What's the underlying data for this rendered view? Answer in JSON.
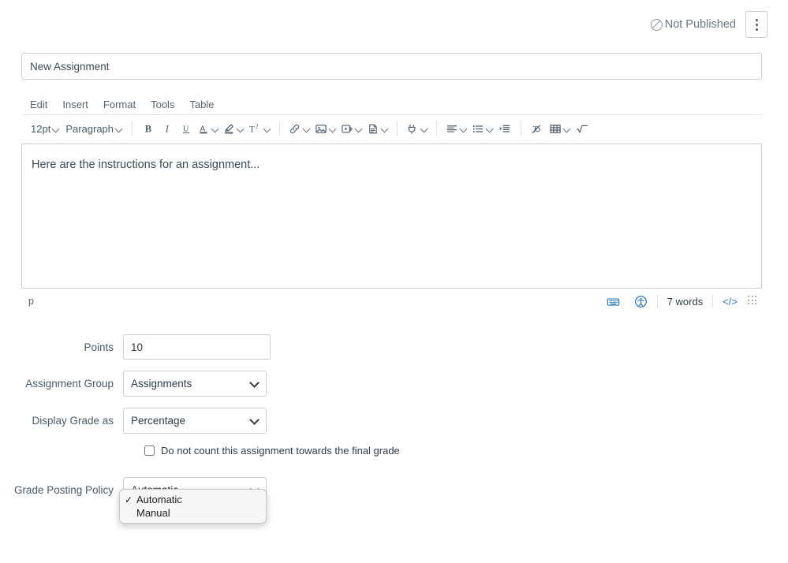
{
  "topbar": {
    "publish_status": "Not Published",
    "publish_icon": "no-entry-icon",
    "kebab_label": "More options",
    "kebab_icon": "kebab-menu-icon"
  },
  "title": {
    "placeholder": "New Assignment",
    "value": ""
  },
  "editor": {
    "menubar": [
      {
        "label": "Edit"
      },
      {
        "label": "Insert"
      },
      {
        "label": "Format"
      },
      {
        "label": "Tools"
      },
      {
        "label": "Table"
      }
    ],
    "toolbar": {
      "font_size": "12pt",
      "block_format": "Paragraph",
      "bold": "B",
      "italic": "I",
      "underline": "U",
      "text_color": "A",
      "highlight": "highlight-icon",
      "superscript": "T²",
      "link": "link-icon",
      "image": "image-icon",
      "media": "media-icon",
      "document": "document-icon",
      "apps": "plug-icon",
      "align": "align-left-icon",
      "list": "bulleted-list-icon",
      "indent": "indent-icon",
      "clear_format": "clear-formatting-icon",
      "table": "table-icon",
      "equation": "math-equation-icon"
    },
    "body_text": "Here are the instructions for an assignment...",
    "statusbar": {
      "element_path": "p",
      "keyboard_icon": "keyboard-shortcuts-icon",
      "accessibility_icon": "accessibility-checker-icon",
      "word_count": "7 words",
      "html_editor": "</>",
      "resize_handle": "resize-grip-icon"
    }
  },
  "form": {
    "points": {
      "label": "Points",
      "value": "10"
    },
    "assignment_group": {
      "label": "Assignment Group",
      "value": "Assignments",
      "options": [
        "Assignments"
      ]
    },
    "display_grade_as": {
      "label": "Display Grade as",
      "value": "Percentage",
      "options": [
        "Percentage"
      ]
    },
    "omit_from_final": {
      "label": "Do not count this assignment towards the final grade",
      "checked": false
    },
    "grade_posting_policy": {
      "label": "Grade Posting Policy",
      "value": "Automatic",
      "options": [
        "Automatic",
        "Manual"
      ]
    }
  },
  "dropdown_popup": {
    "open": true,
    "items": [
      {
        "label": "Automatic",
        "checkmark": "✓",
        "selected": true
      },
      {
        "label": "Manual",
        "checkmark": "",
        "selected": false
      }
    ]
  }
}
